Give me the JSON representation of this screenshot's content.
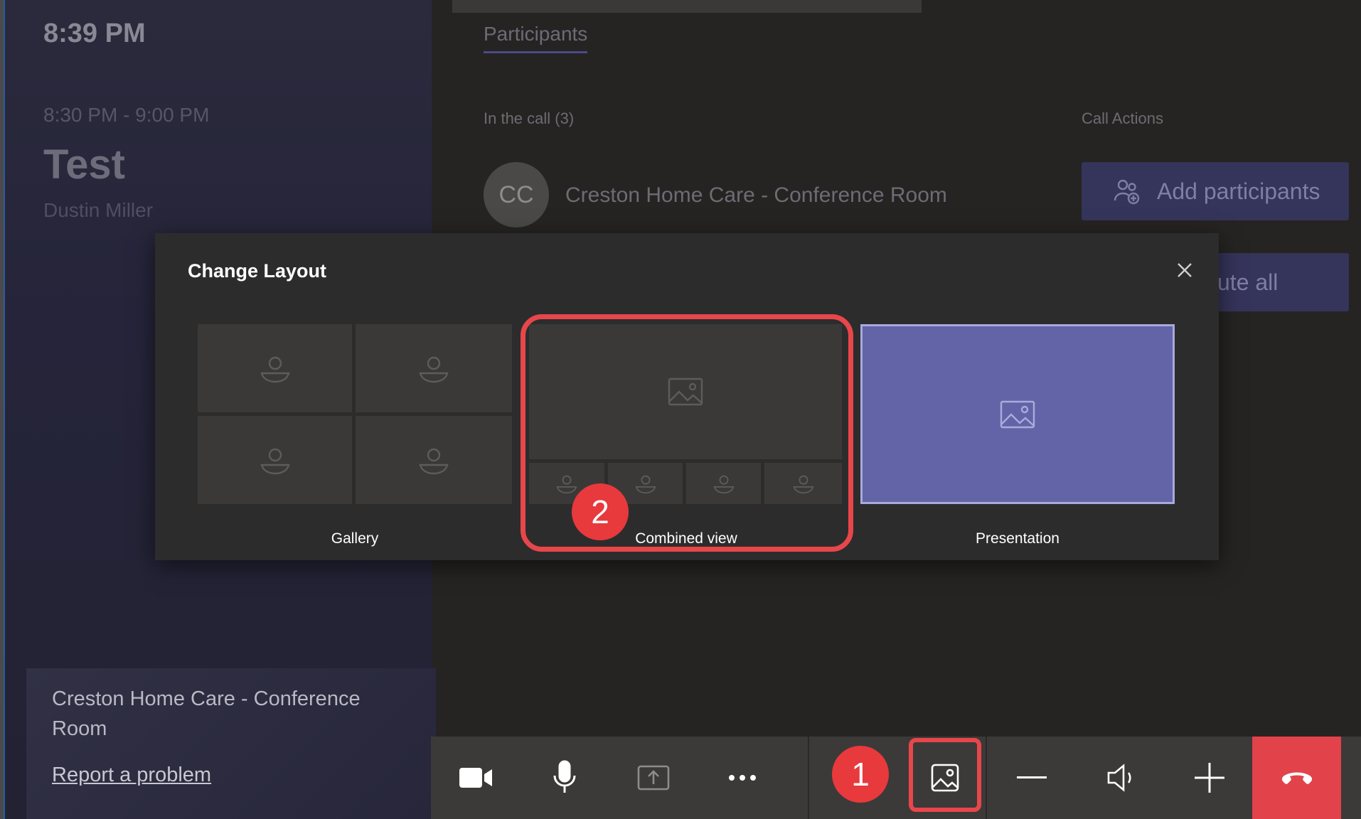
{
  "meeting": {
    "clock": "8:39 PM",
    "time_range": "8:30 PM - 9:00 PM",
    "title": "Test",
    "organizer": "Dustin Miller",
    "room_name": "Creston Home Care - Conference Room",
    "report_link": "Report a problem"
  },
  "participants": {
    "tab_label": "Participants",
    "in_call_label": "In the call (3)",
    "call_actions_label": "Call Actions",
    "participant": {
      "initials": "CC",
      "name": "Creston Home Care - Conference Room"
    },
    "add_button": "Add participants",
    "mute_button_visible": "ute all"
  },
  "modal": {
    "title": "Change Layout",
    "close_icon": "close-icon",
    "options": [
      {
        "label": "Gallery",
        "icon": "person-icon"
      },
      {
        "label": "Combined view",
        "icon": "image-icon"
      },
      {
        "label": "Presentation",
        "icon": "image-icon",
        "selected": true
      }
    ]
  },
  "annotations": {
    "step1": "1",
    "step2": "2",
    "color": "#e8464a"
  },
  "toolbar": {
    "buttons": [
      "camera-icon",
      "microphone-icon",
      "share-screen-icon",
      "more-options-icon",
      "change-layout-icon",
      "volume-down-icon",
      "speaker-icon",
      "volume-up-icon",
      "hang-up-icon"
    ],
    "hangup_color": "#e2424a"
  },
  "colors": {
    "accent": "#6264a7",
    "background": "#252423",
    "panel": "#2d2c2c"
  }
}
